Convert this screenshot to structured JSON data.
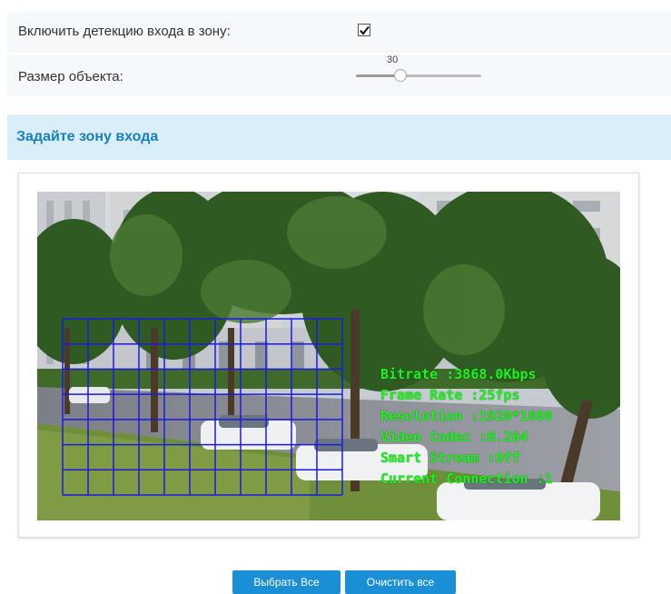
{
  "settings": {
    "enable_label": "Включить детекцию входа в зону:",
    "enable_checked": true,
    "size_label": "Размер объекта:",
    "size_value": "30",
    "size_fraction": 0.3
  },
  "zone": {
    "title": "Задайте зону входа",
    "grid": {
      "columns": 11,
      "rows": 7,
      "color": "#1a1ae0"
    }
  },
  "osd": {
    "lines": [
      "Bitrate :3868.0Kbps",
      "Frame Rate :25fps",
      "Resolution :1920*1080",
      "Video Codec :H.264",
      "Smart Stream :Off",
      "Current Connection :1"
    ],
    "color": "#1ef21e"
  },
  "buttons": {
    "select_all": "Выбрать Все",
    "clear_all": "Очистить все"
  },
  "colors": {
    "accent": "#1a8fd6",
    "section_bg": "#d9eef8",
    "title": "#1680c3"
  }
}
